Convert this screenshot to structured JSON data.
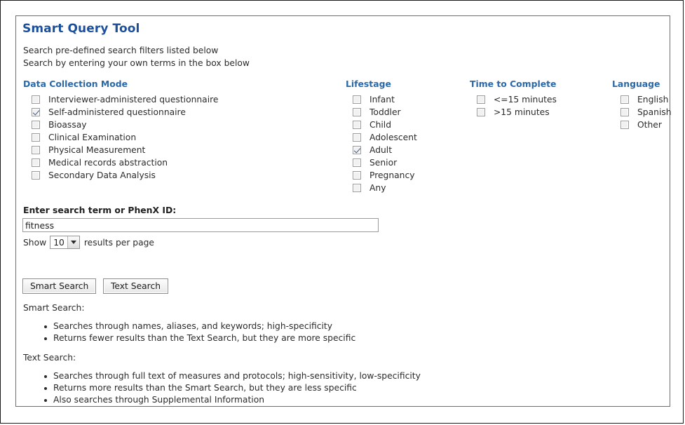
{
  "page": {
    "title": "Smart Query Tool",
    "subtitle_line_1": "Search pre-defined search filters listed below",
    "subtitle_line_2": "Search by entering your own terms in the box below",
    "title_color": "#1b4f9c",
    "section_header_color": "#2b68a8"
  },
  "filters": {
    "data_collection_mode": {
      "title": "Data Collection Mode",
      "options": [
        {
          "label": "Interviewer-administered questionnaire",
          "checked": false
        },
        {
          "label": "Self-administered questionnaire",
          "checked": true
        },
        {
          "label": "Bioassay",
          "checked": false
        },
        {
          "label": "Clinical Examination",
          "checked": false
        },
        {
          "label": "Physical Measurement",
          "checked": false
        },
        {
          "label": "Medical records abstraction",
          "checked": false
        },
        {
          "label": "Secondary Data Analysis",
          "checked": false
        }
      ]
    },
    "lifestage": {
      "title": "Lifestage",
      "options": [
        {
          "label": "Infant",
          "checked": false
        },
        {
          "label": "Toddler",
          "checked": false
        },
        {
          "label": "Child",
          "checked": false
        },
        {
          "label": "Adolescent",
          "checked": false
        },
        {
          "label": "Adult",
          "checked": true
        },
        {
          "label": "Senior",
          "checked": false
        },
        {
          "label": "Pregnancy",
          "checked": false
        },
        {
          "label": "Any",
          "checked": false
        }
      ]
    },
    "time_to_complete": {
      "title": "Time to Complete",
      "options": [
        {
          "label": "<=15 minutes",
          "checked": false
        },
        {
          "label": ">15 minutes",
          "checked": false
        }
      ]
    },
    "language": {
      "title": "Language",
      "options": [
        {
          "label": "English",
          "checked": false
        },
        {
          "label": "Spanish",
          "checked": false
        },
        {
          "label": "Other",
          "checked": false
        }
      ]
    }
  },
  "search": {
    "label": "Enter search term or PhenX ID:",
    "value": "fitness",
    "placeholder": ""
  },
  "results_per_page": {
    "prefix": "Show",
    "value": "10",
    "suffix": "results per page",
    "arrow_icon": "chevron-down-icon"
  },
  "buttons": {
    "smart_search": "Smart Search",
    "text_search": "Text Search"
  },
  "help": {
    "smart_search": {
      "heading": "Smart Search:",
      "bullets": [
        "Searches through names, aliases, and keywords; high-specificity",
        "Returns fewer results than the Text Search, but they are more specific"
      ]
    },
    "text_search": {
      "heading": "Text Search:",
      "bullets": [
        "Searches through full text of measures and protocols; high-sensitivity, low-specificity",
        "Returns more results than the Smart Search, but they are less specific",
        "Also searches through Supplemental Information"
      ]
    }
  }
}
